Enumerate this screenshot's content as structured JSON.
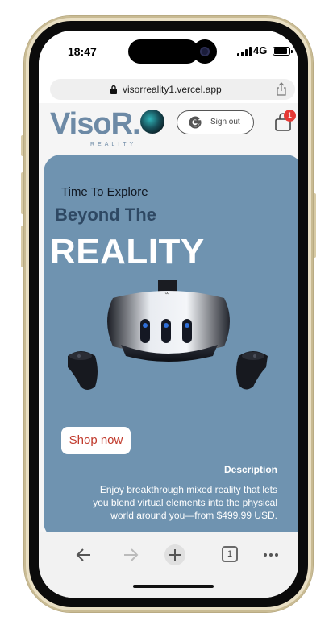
{
  "status_bar": {
    "time": "18:47",
    "network": "4G"
  },
  "browser": {
    "url": "visorreality1.vercel.app",
    "tab_count": "1"
  },
  "header": {
    "logo_text": "VisoR.",
    "logo_subtext": "REALITY",
    "sign_out_label": "Sign out",
    "cart_count": "1"
  },
  "hero": {
    "kicker": "Time To Explore",
    "title_line1": "Beyond The",
    "title_line2": "REALITY",
    "cta_label": "Shop now",
    "description_heading": "Description",
    "description_text": "Enjoy breakthrough mixed reality that lets you blend virtual elements into the physical world around you—from $499.99 USD."
  },
  "colors": {
    "hero_bg": "#6f93b0",
    "logo": "#6d8aa6",
    "cta_text": "#c0392b",
    "badge": "#e53935"
  },
  "icons": [
    "lock-icon",
    "share-icon",
    "google-icon",
    "cart-icon",
    "back-icon",
    "forward-icon",
    "new-tab-icon",
    "tabs-icon",
    "more-icon"
  ]
}
